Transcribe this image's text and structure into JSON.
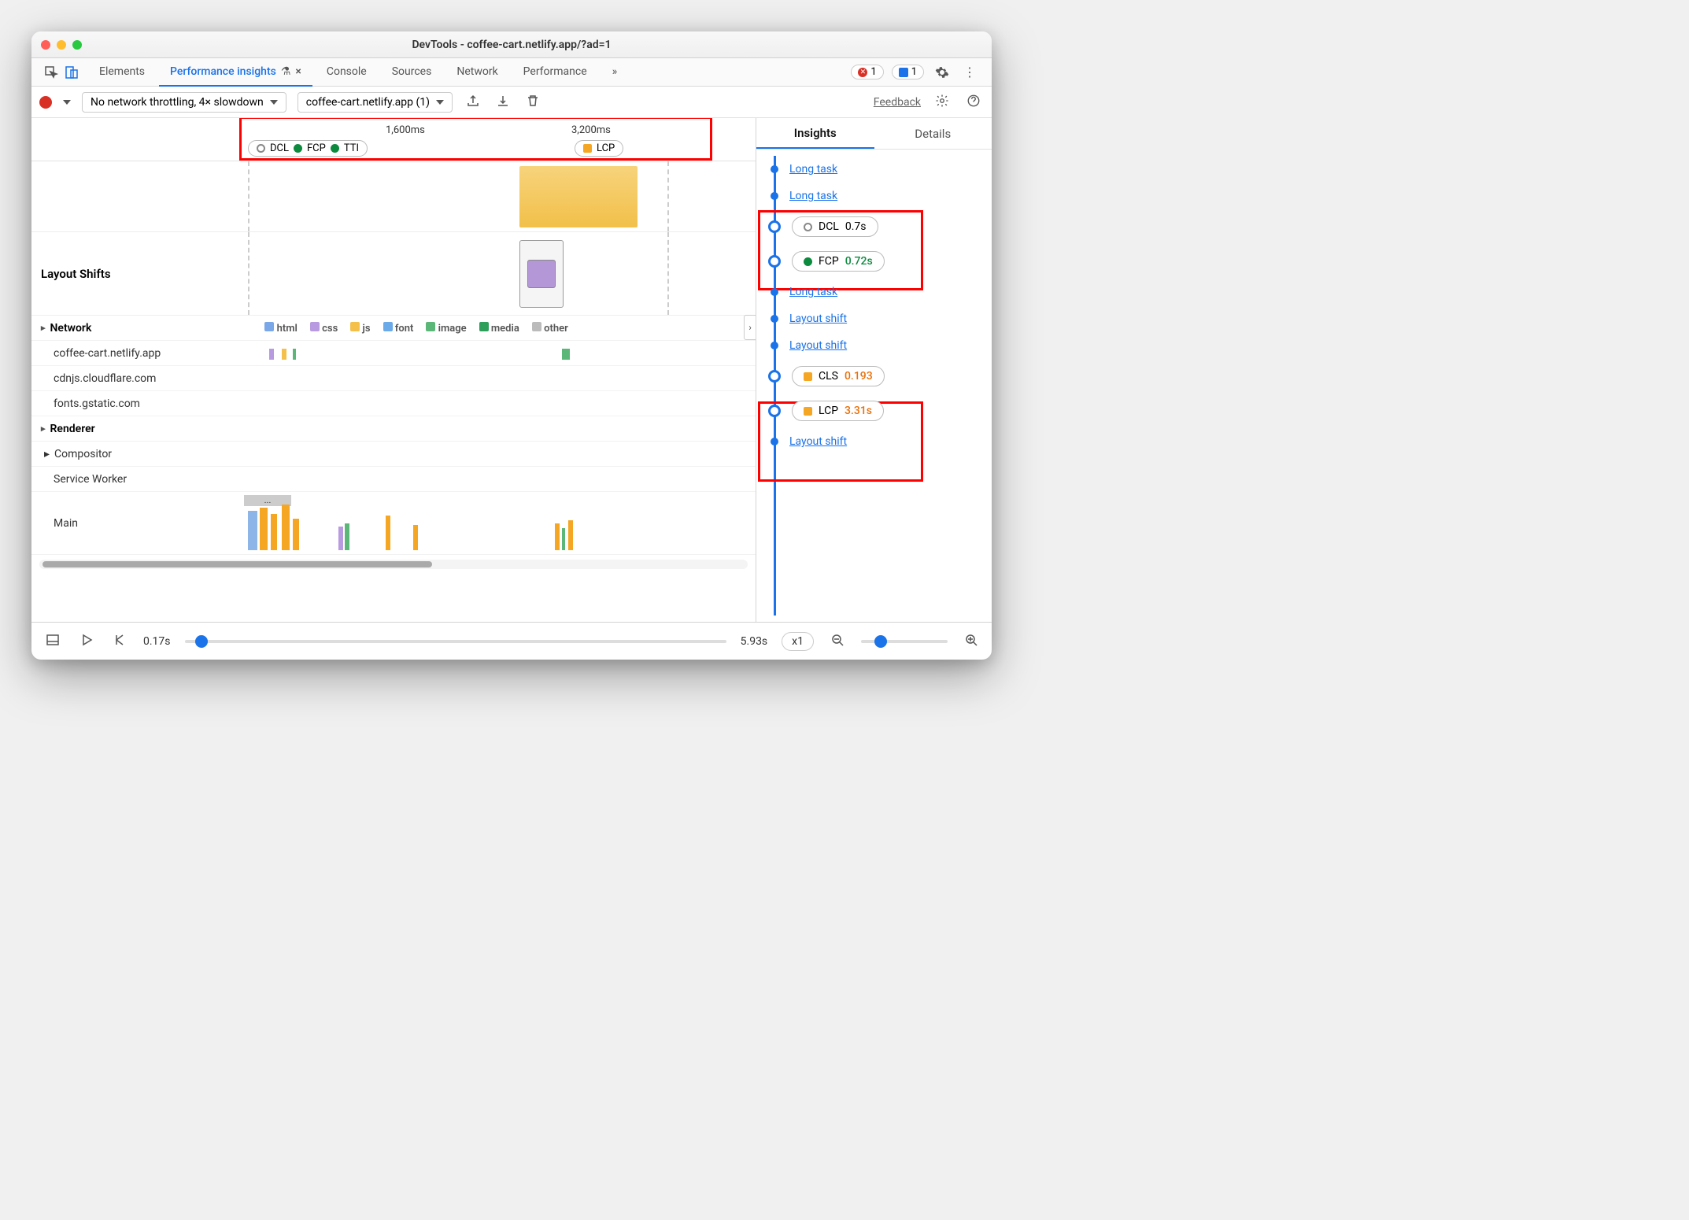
{
  "titlebar": {
    "title": "DevTools - coffee-cart.netlify.app/?ad=1"
  },
  "tabs": {
    "elements": "Elements",
    "perf_insights": "Performance insights",
    "console": "Console",
    "sources": "Sources",
    "network": "Network",
    "performance": "Performance",
    "more": "»"
  },
  "badges": {
    "error_count": "1",
    "issue_count": "1"
  },
  "toolbar": {
    "throttle": "No network throttling, 4× slowdown",
    "page_select": "coffee-cart.netlify.app (1)",
    "feedback": "Feedback"
  },
  "timeline": {
    "t1": "1,600ms",
    "t2": "3,200ms",
    "pill1": {
      "dcl": "DCL",
      "fcp": "FCP",
      "tti": "TTI"
    },
    "pill2": {
      "lcp": "LCP"
    }
  },
  "sections": {
    "layout_shifts": "Layout Shifts",
    "network": "Network",
    "renderer": "Renderer",
    "compositor": "Compositor",
    "service_worker": "Service Worker",
    "main": "Main"
  },
  "network_hosts": [
    "coffee-cart.netlify.app",
    "cdnjs.cloudflare.com",
    "fonts.gstatic.com"
  ],
  "legend": {
    "html": "html",
    "css": "css",
    "js": "js",
    "font": "font",
    "image": "image",
    "media": "media",
    "other": "other"
  },
  "playbar": {
    "start": "0.17s",
    "end": "5.93s",
    "speed": "x1"
  },
  "right": {
    "tab_insights": "Insights",
    "tab_details": "Details",
    "items": [
      {
        "type": "link",
        "label": "Long task"
      },
      {
        "type": "link",
        "label": "Long task"
      },
      {
        "type": "pill",
        "major": true,
        "icon": "empty",
        "label": "DCL",
        "value": "0.7s",
        "valClass": ""
      },
      {
        "type": "pill",
        "major": true,
        "icon": "green",
        "label": "FCP",
        "value": "0.72s",
        "valClass": "pill-val-green"
      },
      {
        "type": "link",
        "label": "Long task"
      },
      {
        "type": "link",
        "label": "Layout shift"
      },
      {
        "type": "link",
        "label": "Layout shift"
      },
      {
        "type": "pill",
        "major": true,
        "icon": "orange",
        "label": "CLS",
        "value": "0.193",
        "valClass": "pill-val-orange"
      },
      {
        "type": "pill",
        "major": true,
        "icon": "orange",
        "label": "LCP",
        "value": "3.31s",
        "valClass": "pill-val-orange"
      },
      {
        "type": "link",
        "label": "Layout shift"
      }
    ]
  }
}
